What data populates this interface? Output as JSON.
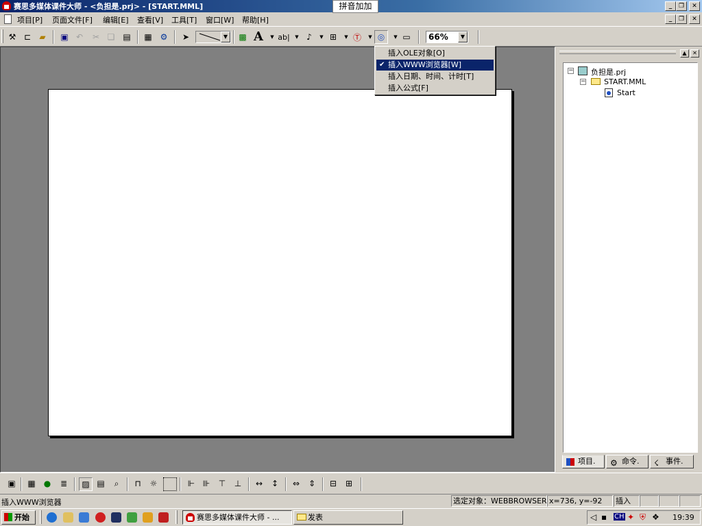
{
  "window": {
    "title": "赛思多媒体课件大师 - <负担是.prj> - [START.MML]",
    "ime_label": "拼音加加"
  },
  "menu": {
    "items": [
      "项目[P]",
      "页面文件[F]",
      "编辑[E]",
      "查看[V]",
      "工具[T]",
      "窗口[W]",
      "帮助[H]"
    ]
  },
  "toolbar": {
    "text_tool_glyph": "A",
    "ab_tool_glyph": "ab|",
    "zoom_value": "66%"
  },
  "dropdown": {
    "items": [
      {
        "label": "插入OLE对象[O]",
        "checked": false
      },
      {
        "label": "插入WWW浏览器[W]",
        "checked": true
      },
      {
        "label": "插入日期、时间、计时[T]",
        "checked": false
      },
      {
        "label": "插入公式[F]",
        "checked": false
      }
    ],
    "check_glyph": "✔"
  },
  "tree": {
    "root": "负担是.prj",
    "file": "START.MML",
    "page": "Start"
  },
  "panel_tabs": [
    "项目",
    "命令",
    "事件"
  ],
  "status": {
    "message": "插入WWW浏览器",
    "selected_object": "选定对象：WEBBROWSER",
    "coords": "x=736, y=-92",
    "mode": "插入"
  },
  "taskbar": {
    "start_label": "开始",
    "tasks": [
      "赛思多媒体课件大师 - ...",
      "发表"
    ],
    "tray_lang": "CH",
    "clock": "19:39"
  },
  "colors": {
    "title_active": "#0a246a",
    "workspace": "#808080",
    "face": "#d4d0c8",
    "highlight": "#0a246a"
  }
}
